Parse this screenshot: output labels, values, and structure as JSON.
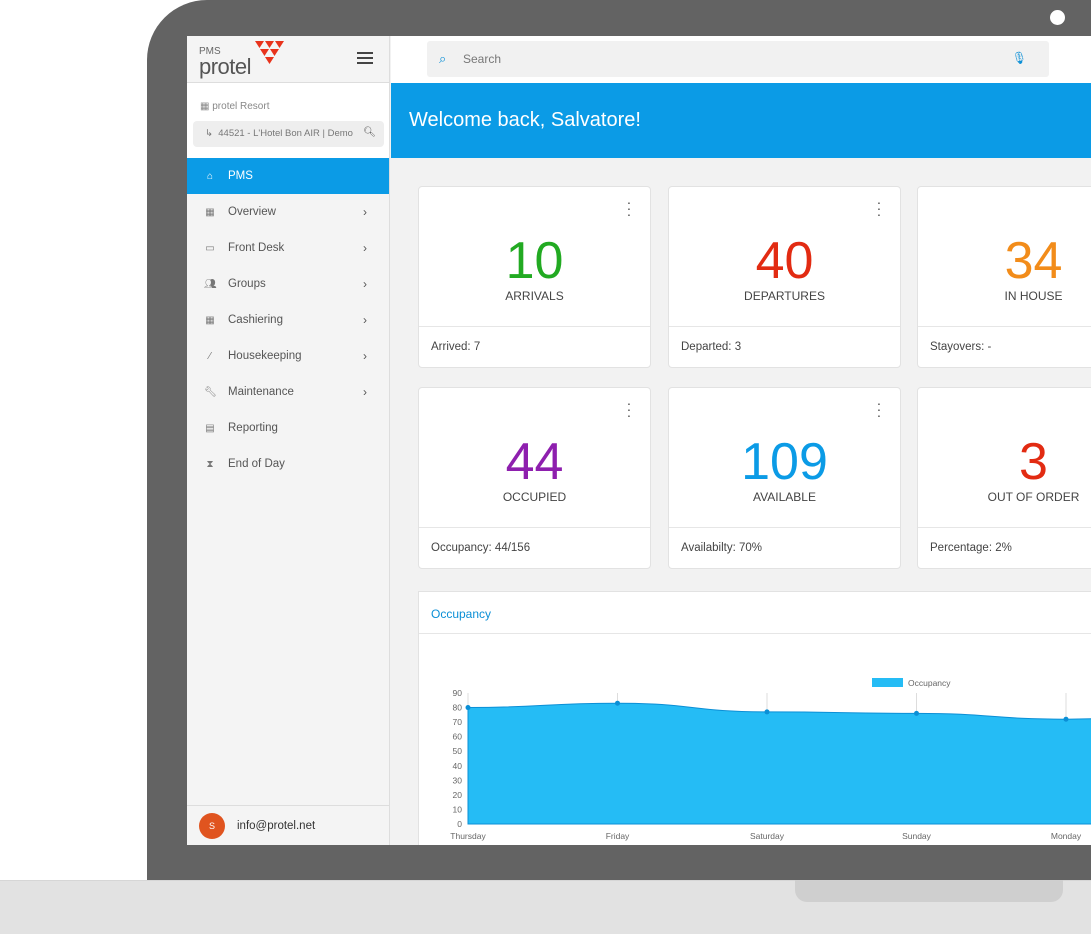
{
  "app": {
    "pms_label": "PMS",
    "brand": "protel",
    "brand_color": "#e8331c"
  },
  "sidebar": {
    "property": "protel Resort",
    "hotel_selector": "44521 - L'Hotel  Bon AIR | Demo",
    "items": [
      {
        "label": "PMS",
        "icon": "home-icon",
        "active": true
      },
      {
        "label": "Overview",
        "icon": "grid-icon",
        "chevron": true
      },
      {
        "label": "Front Desk",
        "icon": "desk-icon",
        "chevron": true
      },
      {
        "label": "Groups",
        "icon": "people-icon",
        "chevron": true
      },
      {
        "label": "Cashiering",
        "icon": "calculator-icon",
        "chevron": true
      },
      {
        "label": "Housekeeping",
        "icon": "brush-icon",
        "chevron": true
      },
      {
        "label": "Maintenance",
        "icon": "wrench-icon",
        "chevron": true
      },
      {
        "label": "Reporting",
        "icon": "report-icon"
      },
      {
        "label": "End of Day",
        "icon": "hourglass-icon"
      }
    ],
    "user": {
      "initial": "S",
      "email": "info@protel.net"
    }
  },
  "search": {
    "placeholder": "Search"
  },
  "banner": {
    "text": "Welcome back, Salvatore!"
  },
  "cards": [
    {
      "value": "10",
      "label": "ARRIVALS",
      "footer": "Arrived:  7",
      "color": "#22aa22"
    },
    {
      "value": "40",
      "label": "DEPARTURES",
      "footer": "Departed:  3",
      "color": "#e22b12"
    },
    {
      "value": "34",
      "label": "IN HOUSE",
      "footer": "Stayovers:  -",
      "color": "#f28c1a"
    },
    {
      "value": "44",
      "label": "OCCUPIED",
      "footer": "Occupancy:  44/156",
      "color": "#8e1fae"
    },
    {
      "value": "109",
      "label": "AVAILABLE",
      "footer": "Availabilty:  70%",
      "color": "#0b9be6"
    },
    {
      "value": "3",
      "label": "OUT OF ORDER",
      "footer": "Percentage:  2%",
      "color": "#e22b12"
    }
  ],
  "occupancy_panel": {
    "title": "Occupancy"
  },
  "chart_data": {
    "type": "area",
    "categories": [
      "Thursday",
      "Friday",
      "Saturday",
      "Sunday",
      "Monday"
    ],
    "series": [
      {
        "name": "Occupancy",
        "values": [
          80,
          83,
          77,
          76,
          72
        ],
        "color": "#25bcf5"
      }
    ],
    "yticks": [
      0,
      10,
      20,
      30,
      40,
      50,
      60,
      70,
      80,
      90
    ],
    "ylim": [
      0,
      90
    ],
    "legend": "top"
  }
}
